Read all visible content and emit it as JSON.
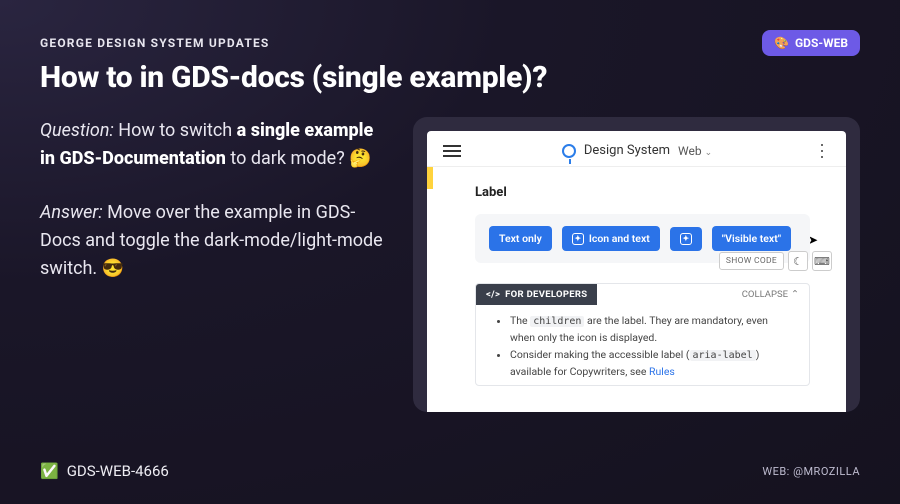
{
  "eyebrow": "GEORGE DESIGN SYSTEM UPDATES",
  "badge": {
    "icon": "🎨",
    "label": "GDS-WEB"
  },
  "title": "How to in GDS-docs (single example)?",
  "qa": {
    "question_label": "Question:",
    "question_pre": " How to switch ",
    "question_bold": "a single example in GDS-Documentation",
    "question_post": " to dark mode? ",
    "question_emoji": "🤔",
    "answer_label": "Answer:",
    "answer_text": " Move over the example in GDS-Docs and toggle the dark-mode/light-mode switch. ",
    "answer_emoji": "😎"
  },
  "screenshot": {
    "app_name": "Design System",
    "platform_selector": "Web",
    "section_title": "Label",
    "chips": {
      "text_only": "Text only",
      "icon_and_text": "Icon and text",
      "visible_text": "\"Visible text\""
    },
    "toolbar": {
      "show_code": "SHOW CODE"
    },
    "developers": {
      "heading": "FOR DEVELOPERS",
      "collapse": "COLLAPSE",
      "bullet1_pre": "The ",
      "bullet1_code": "children",
      "bullet1_post": " are the label. They are mandatory, even when only the icon is displayed.",
      "bullet2_pre": "Consider making the accessible label (",
      "bullet2_code": "aria-label",
      "bullet2_mid": ") available for Copywriters, see ",
      "bullet2_link": "Rules"
    }
  },
  "footer": {
    "ticket_emoji": "✅",
    "ticket_id": "GDS-WEB-4666",
    "credit_label": "WEB: ",
    "credit_handle": "@MROZILLA"
  }
}
